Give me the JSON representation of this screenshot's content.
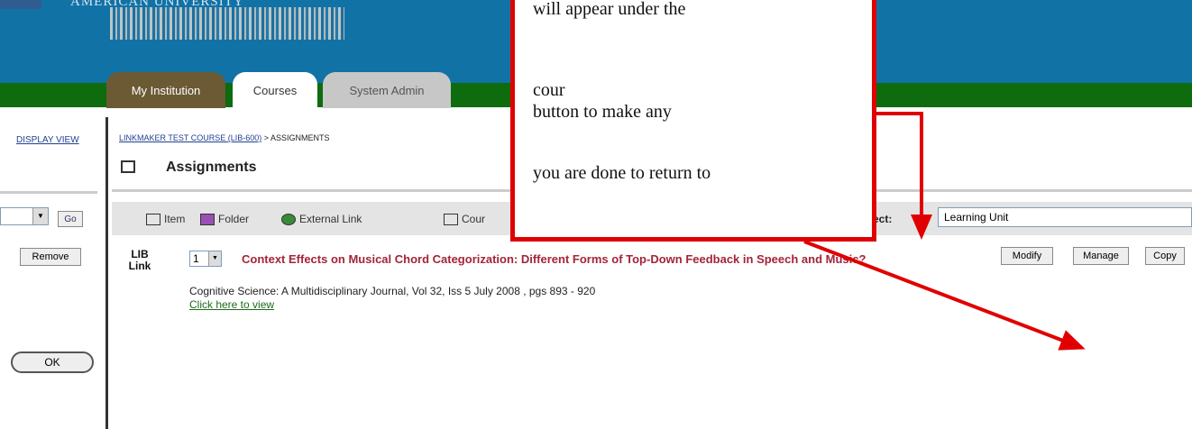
{
  "header": {
    "logo_text": "AMERICAN UNIVERSITY",
    "tabs": [
      {
        "label": "My Institution"
      },
      {
        "label": "Courses"
      },
      {
        "label": "System Admin"
      }
    ]
  },
  "left_panel": {
    "display_view": "DISPLAY VIEW",
    "go_label": "Go",
    "remove_label": "Remove",
    "ok_label": "OK"
  },
  "breadcrumb": {
    "course": "LINKMAKER TEST COURSE (LIB-600)",
    "separator": " > ",
    "current": "ASSIGNMENTS"
  },
  "page": {
    "title": "Assignments"
  },
  "toolbar": {
    "item_label": "Item",
    "folder_label": "Folder",
    "external_link_label": "External Link",
    "cour_label": "Cour",
    "select_label": "elect:",
    "select_value": "Learning Unit"
  },
  "content_item": {
    "icon_text_1": "LIB",
    "icon_text_2": "Link",
    "order_value": "1",
    "title": "Context Effects on Musical Chord Categorization: Different Forms of Top-Down Feedback in Speech and Music?",
    "citation": "Cognitive Science: A Multidisciplinary Journal, Vol 32, Iss 5 July 2008 , pgs 893 - 920",
    "view_link": "Click here to view",
    "modify_label": "Modify",
    "manage_label": "Manage",
    "copy_label": "Copy"
  },
  "callout": {
    "lines": [
      "will appear under the",
      "cour",
      "button to make any",
      "you are done to return to"
    ],
    "color": "#e00000"
  },
  "colors": {
    "header_blue": "#1172a6",
    "header_green": "#0e6b0e",
    "title_red": "#a3243a",
    "link_green": "#1c6b1c"
  }
}
